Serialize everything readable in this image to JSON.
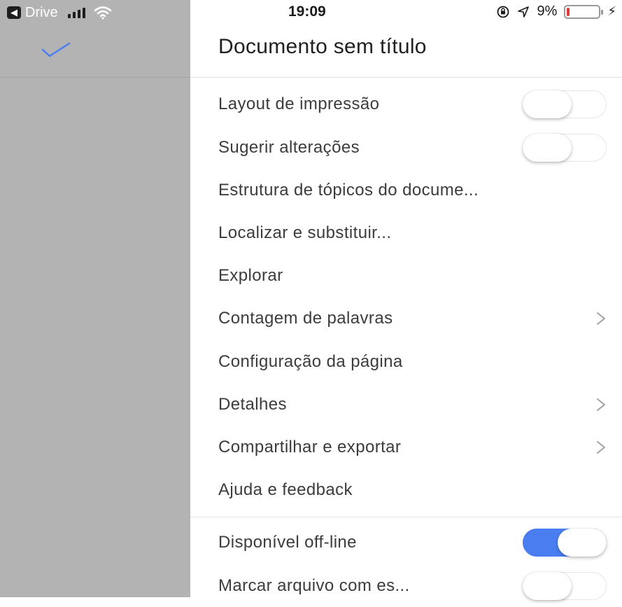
{
  "status_bar": {
    "back_app": "Drive",
    "time": "19:09",
    "battery_percent": "9%",
    "battery_level": 0.09
  },
  "document": {
    "title": "Documento sem título"
  },
  "menu": {
    "items": [
      {
        "label": "Layout de impressão",
        "control": "toggle",
        "on": false
      },
      {
        "label": "Sugerir alterações",
        "control": "toggle",
        "on": false
      },
      {
        "label": "Estrutura de tópicos do docume...",
        "control": "none"
      },
      {
        "label": "Localizar e substituir...",
        "control": "none"
      },
      {
        "label": "Explorar",
        "control": "none"
      },
      {
        "label": "Contagem de palavras",
        "control": "chevron"
      },
      {
        "label": "Configuração da página",
        "control": "none"
      },
      {
        "label": "Detalhes",
        "control": "chevron"
      },
      {
        "label": "Compartilhar e exportar",
        "control": "chevron"
      },
      {
        "label": "Ajuda e feedback",
        "control": "none"
      },
      {
        "label": "Disponível off-line",
        "control": "toggle",
        "on": true
      },
      {
        "label": "Marcar arquivo com es...",
        "control": "toggle",
        "on": false
      }
    ]
  },
  "colors": {
    "accent": "#4a7df0",
    "scrim": "#b3b3b3",
    "battery_low": "#e53935"
  },
  "icons": {
    "done": "checkmark-icon",
    "chevron": "chevron-right-icon",
    "back": "back-arrow-icon",
    "signal": "signal-icon",
    "wifi": "wifi-icon",
    "orientation_lock": "orientation-lock-icon",
    "location": "location-arrow-icon",
    "charging": "charging-bolt-icon"
  }
}
